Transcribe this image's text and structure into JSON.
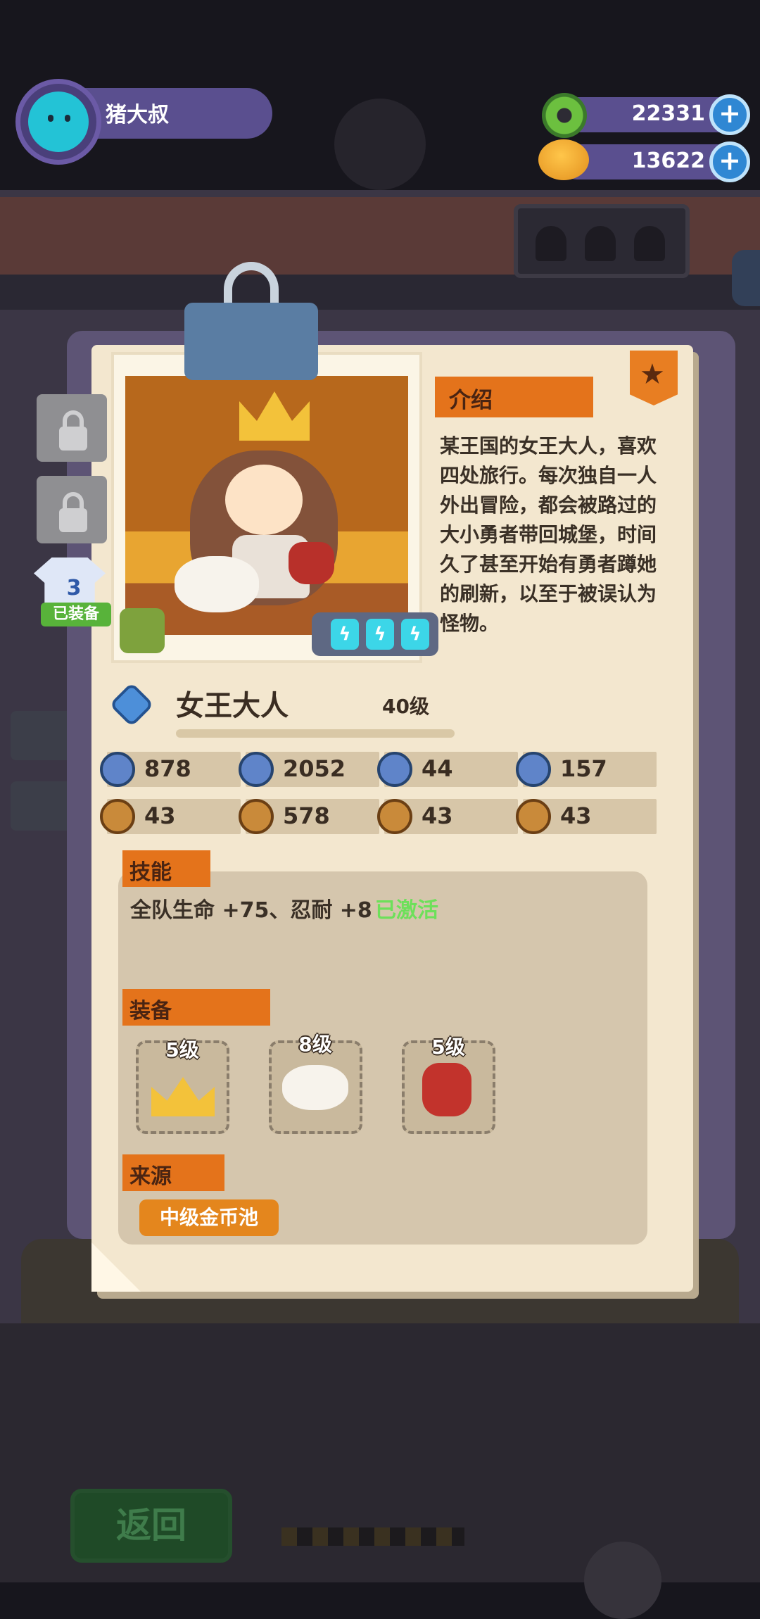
{
  "player": {
    "name": "猪大叔"
  },
  "currencies": [
    {
      "icon": "donut-coin-icon",
      "value": "22331"
    },
    {
      "icon": "planet-coin-icon",
      "value": "13622"
    }
  ],
  "side_tabs": {
    "equipped_count": "3",
    "equipped_label": "已装备"
  },
  "hero": {
    "name": "女王大人",
    "level": "40级",
    "intro_title": "介绍",
    "intro_text": "某王国的女王大人，喜欢四处旅行。每次独自一人外出冒险，都会被路过的大小勇者带回城堡，时间久了甚至开始有勇者蹲她的刷新，以至于被误认为怪物。"
  },
  "stats": [
    {
      "icon": "heart-shield-icon",
      "value": "878"
    },
    {
      "icon": "sword-shield-icon",
      "value": "2052"
    },
    {
      "icon": "shield-icon",
      "value": "44"
    },
    {
      "icon": "anchor-shield-icon",
      "value": "157"
    },
    {
      "icon": "boot-icon",
      "value": "43"
    },
    {
      "icon": "smile-icon",
      "value": "578"
    },
    {
      "icon": "muscle-icon",
      "value": "43"
    },
    {
      "icon": "brain-icon",
      "value": "43"
    }
  ],
  "skill": {
    "title": "技能",
    "text": "全队生命 +75、忍耐 +8",
    "status": "已激活"
  },
  "equipment": {
    "title": "装备",
    "items": [
      {
        "level": "5级",
        "icon": "crown-icon"
      },
      {
        "level": "8级",
        "icon": "dog-icon"
      },
      {
        "level": "5级",
        "icon": "bag-icon"
      }
    ]
  },
  "source": {
    "title": "来源",
    "value": "中级金币池"
  },
  "bottom": {
    "back_label": "返回"
  }
}
